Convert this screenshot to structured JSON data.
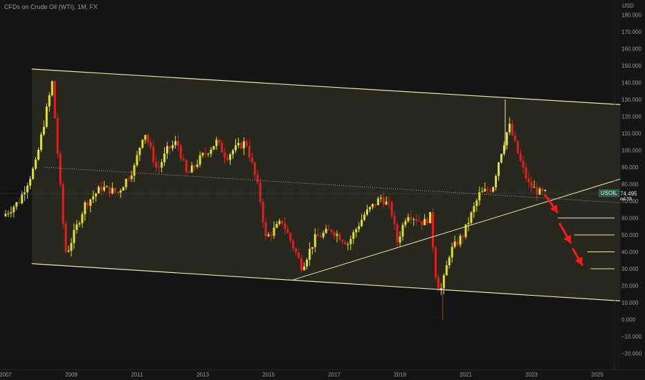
{
  "title": "CFDs on Crude Oil (WTI), 1M, FX",
  "currency": "USD",
  "symbol": "USOIL",
  "last_price": "74.495",
  "countdown": "od 5h",
  "colors": {
    "up": "#e0e030",
    "down": "#e02020",
    "lines": "#e8e8b0",
    "background": "#141414",
    "arrow": "#ff1a1a"
  },
  "chart_data": {
    "type": "candlestick",
    "ylim": [
      -25,
      185
    ],
    "y_ticks": [
      -20,
      -10,
      0,
      10,
      20,
      30,
      40,
      50,
      60,
      70,
      80,
      90,
      100,
      110,
      120,
      130,
      140,
      150,
      160,
      170,
      180
    ],
    "y_tick_labels": [
      "−20.000",
      "−10.000",
      "0.000",
      "10.000",
      "20.000",
      "30.000",
      "40.000",
      "50.000",
      "60.000",
      "70.000",
      "80.000",
      "90.000",
      "100.000",
      "110.000",
      "120.000",
      "130.000",
      "140.000",
      "150.000",
      "160.000",
      "170.000",
      "180.000"
    ],
    "x_ticks": [
      2007,
      2009,
      2011,
      2013,
      2015,
      2017,
      2019,
      2021,
      2023,
      2025
    ],
    "x_tick_labels": [
      "2007",
      "2009",
      "2011",
      "2013",
      "2015",
      "2017",
      "2019",
      "2021",
      "2023",
      "2025"
    ],
    "price_path": [
      [
        2007.0,
        61
      ],
      [
        2007.5,
        70
      ],
      [
        2008.0,
        92
      ],
      [
        2008.5,
        140
      ],
      [
        2008.9,
        40
      ],
      [
        2009.0,
        42
      ],
      [
        2009.5,
        68
      ],
      [
        2010.0,
        78
      ],
      [
        2010.5,
        75
      ],
      [
        2011.0,
        90
      ],
      [
        2011.3,
        112
      ],
      [
        2011.7,
        88
      ],
      [
        2012.0,
        100
      ],
      [
        2012.3,
        105
      ],
      [
        2012.6,
        85
      ],
      [
        2013.0,
        95
      ],
      [
        2013.5,
        105
      ],
      [
        2013.8,
        96
      ],
      [
        2014.0,
        100
      ],
      [
        2014.4,
        105
      ],
      [
        2014.8,
        75
      ],
      [
        2015.0,
        48
      ],
      [
        2015.5,
        58
      ],
      [
        2015.9,
        40
      ],
      [
        2016.1,
        31
      ],
      [
        2016.5,
        48
      ],
      [
        2017.0,
        53
      ],
      [
        2017.5,
        45
      ],
      [
        2018.0,
        62
      ],
      [
        2018.5,
        72
      ],
      [
        2018.8,
        66
      ],
      [
        2019.0,
        46
      ],
      [
        2019.3,
        63
      ],
      [
        2019.8,
        57
      ],
      [
        2020.0,
        61
      ],
      [
        2020.2,
        20
      ],
      [
        2020.35,
        18
      ],
      [
        2020.6,
        40
      ],
      [
        2021.0,
        50
      ],
      [
        2021.5,
        74
      ],
      [
        2021.9,
        78
      ],
      [
        2022.1,
        95
      ],
      [
        2022.4,
        115
      ],
      [
        2022.8,
        90
      ],
      [
        2023.0,
        80
      ],
      [
        2023.3,
        75
      ],
      [
        2023.45,
        74.5
      ]
    ],
    "channel_top": [
      [
        2007.8,
        148
      ],
      [
        2025.7,
        127
      ]
    ],
    "channel_bottom": [
      [
        2007.8,
        33
      ],
      [
        2025.7,
        11
      ]
    ],
    "support_line": [
      [
        2015.75,
        23.5
      ],
      [
        2025.7,
        83
      ]
    ],
    "dotted_trend": [
      [
        2008.2,
        90
      ],
      [
        2025.7,
        69
      ]
    ],
    "target_levels": [
      {
        "label": "60.000",
        "value": 60,
        "from": 2023.8
      },
      {
        "label": "50.000",
        "value": 50,
        "from": 2024.3
      },
      {
        "label": "40.000",
        "value": 40,
        "from": 2024.7
      },
      {
        "label": "30.000",
        "value": 30,
        "from": 2024.8
      }
    ],
    "arrows": [
      [
        [
          2023.4,
          74
        ],
        [
          2023.8,
          63
        ]
      ],
      [
        [
          2023.85,
          57
        ],
        [
          2024.2,
          45
        ]
      ],
      [
        [
          2024.25,
          42
        ],
        [
          2024.55,
          32
        ]
      ]
    ]
  }
}
